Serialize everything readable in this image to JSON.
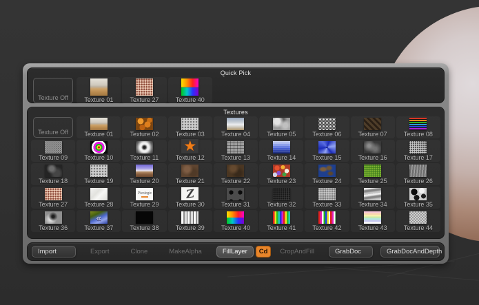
{
  "colors": {
    "accent_orange": "#e8852a",
    "canvas_bg": "#303030",
    "panel_frame": "#8b8b8b",
    "subpanel_bg": "#272727"
  },
  "quick_pick": {
    "title": "Quick Pick",
    "items": [
      {
        "label": "Texture Off",
        "type": "off"
      },
      {
        "label": "Texture 01",
        "swatch": "room"
      },
      {
        "label": "Texture 27",
        "swatch": "granite"
      },
      {
        "label": "Texture 40",
        "swatch": "huegrid"
      }
    ]
  },
  "textures": {
    "title": "Textures",
    "items": [
      {
        "label": "Texture Off",
        "type": "off"
      },
      {
        "label": "Texture 01",
        "swatch": "room"
      },
      {
        "label": "Texture 02",
        "swatch": "lava"
      },
      {
        "label": "Texture 03",
        "swatch": "dotgrid"
      },
      {
        "label": "Texture 04",
        "swatch": "sky"
      },
      {
        "label": "Texture 05",
        "swatch": "blotch"
      },
      {
        "label": "Texture 06",
        "swatch": "halftone"
      },
      {
        "label": "Texture 07",
        "swatch": "weave"
      },
      {
        "label": "Texture 08",
        "swatch": "rainbowh"
      },
      {
        "label": "Texture 09",
        "swatch": "specklel"
      },
      {
        "label": "Texture 10",
        "swatch": "bullseye"
      },
      {
        "label": "Texture 11",
        "swatch": "donut"
      },
      {
        "label": "Texture 12",
        "swatch": "star"
      },
      {
        "label": "Texture 13",
        "swatch": "blocks"
      },
      {
        "label": "Texture 14",
        "swatch": "water"
      },
      {
        "label": "Texture 15",
        "swatch": "spiral"
      },
      {
        "label": "Texture 16",
        "swatch": "smoked"
      },
      {
        "label": "Texture 17",
        "swatch": "speckleg"
      },
      {
        "label": "Texture 18",
        "swatch": "rockd"
      },
      {
        "label": "Texture 19",
        "swatch": "dotgrid"
      },
      {
        "label": "Texture 20",
        "swatch": "landscape"
      },
      {
        "label": "Texture 21",
        "swatch": "rockb"
      },
      {
        "label": "Texture 22",
        "swatch": "rockb2"
      },
      {
        "label": "Texture 23",
        "swatch": "candy"
      },
      {
        "label": "Texture 24",
        "swatch": "world"
      },
      {
        "label": "Texture 25",
        "swatch": "grass"
      },
      {
        "label": "Texture 26",
        "swatch": "fiber"
      },
      {
        "label": "Texture 27",
        "swatch": "granite"
      },
      {
        "label": "Texture 28",
        "swatch": "marble"
      },
      {
        "label": "Texture 29",
        "swatch": "pixlogo"
      },
      {
        "label": "Texture 30",
        "swatch": "zlogo"
      },
      {
        "label": "Texture 31",
        "swatch": "hexd"
      },
      {
        "label": "Texture 32",
        "swatch": "noised"
      },
      {
        "label": "Texture 33",
        "swatch": "noiseg"
      },
      {
        "label": "Texture 34",
        "swatch": "waves"
      },
      {
        "label": "Texture 35",
        "swatch": "camo"
      },
      {
        "label": "Texture 36",
        "swatch": "smokeg"
      },
      {
        "label": "Texture 37",
        "swatch": "photo"
      },
      {
        "label": "Texture 38",
        "swatch": "black"
      },
      {
        "label": "Texture 39",
        "swatch": "stripesv"
      },
      {
        "label": "Texture 40",
        "swatch": "huegrid"
      },
      {
        "label": "Texture 41",
        "swatch": "rainbowv"
      },
      {
        "label": "Texture 42",
        "swatch": "rainbowv2"
      },
      {
        "label": "Texture 43",
        "swatch": "pastelh"
      },
      {
        "label": "Texture 44",
        "swatch": "checker"
      }
    ]
  },
  "toolbar": {
    "buttons": [
      {
        "label": "Import",
        "style": "raised"
      },
      {
        "label": "Export",
        "style": "disabled"
      },
      {
        "label": "Clone",
        "style": "disabled"
      },
      {
        "label": "MakeAlpha",
        "style": "disabled"
      },
      {
        "label": "FillLayer",
        "style": "light"
      },
      {
        "label": "Cd",
        "style": "orange"
      },
      {
        "label": "CropAndFill",
        "style": "disabled"
      },
      {
        "label": "GrabDoc",
        "style": "raised"
      },
      {
        "label": "GrabDocAndDepth",
        "style": "raised wide"
      }
    ]
  }
}
